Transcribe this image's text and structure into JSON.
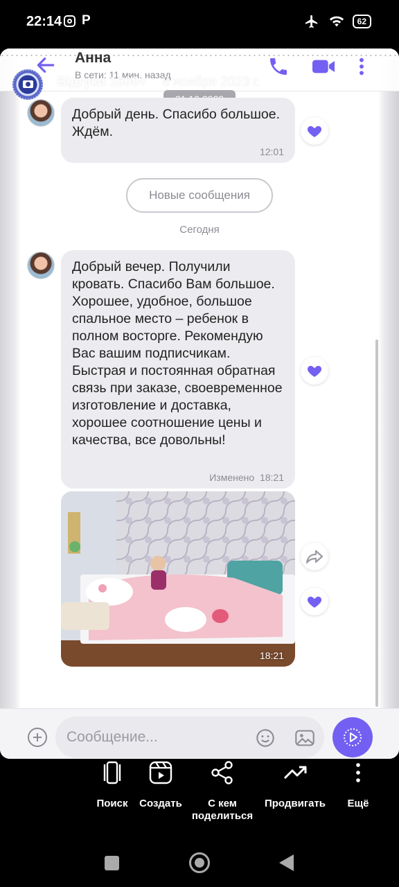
{
  "status_bar": {
    "time": "22:14",
    "battery": "62",
    "icons": [
      "instagram-icon",
      "p-app-icon",
      "airplane-mode-icon",
      "wifi-icon",
      "battery-icon"
    ]
  },
  "chat_header": {
    "contact_name": "Анна",
    "status": "В сети: 11 мин. назад",
    "overlay_title": "Відгуки 1600+",
    "overlay_date": "8 ноября 2023 г.",
    "icons": [
      "back-arrow-icon",
      "phone-icon",
      "video-call-icon",
      "more-vertical-icon"
    ]
  },
  "date_separator": "31.10.2023",
  "messages": [
    {
      "text": "Добрый день. Спасибо большое. Ждём.",
      "time": "12:01"
    },
    {
      "text": "Добрый вечер. Получили кровать. Спасибо Вам большое. Хорошее, удобное, большое спальное место – ребенок в полном восторге. Рекомендую Вас вашим подписчикам. Быстрая и постоянная обратная связь при заказе, своевременное изготовление и доставка, хорошее соотношение цены и качества, все довольны!",
      "edited": "Изменено",
      "time": "18:21"
    },
    {
      "type": "photo",
      "time": "18:21"
    }
  ],
  "new_messages_label": "Новые сообщения",
  "today_label": "Сегодня",
  "composer": {
    "placeholder": "Сообщение...",
    "icons": [
      "add-icon",
      "emoji-icon",
      "gallery-icon",
      "send-icon"
    ]
  },
  "share_toolbar": {
    "items": [
      {
        "label": "Поиск",
        "icon": "lens-search-icon"
      },
      {
        "label": "Создать",
        "icon": "create-reel-icon"
      },
      {
        "label": "С кем поделиться",
        "icon": "share-icon"
      },
      {
        "label": "Продвигать",
        "icon": "trending-up-icon"
      },
      {
        "label": "Ещё",
        "icon": "more-vertical-icon"
      }
    ]
  },
  "colors": {
    "accent": "#7360f2",
    "bubble": "#ececf0",
    "date_pill": "#a7a7ad"
  }
}
